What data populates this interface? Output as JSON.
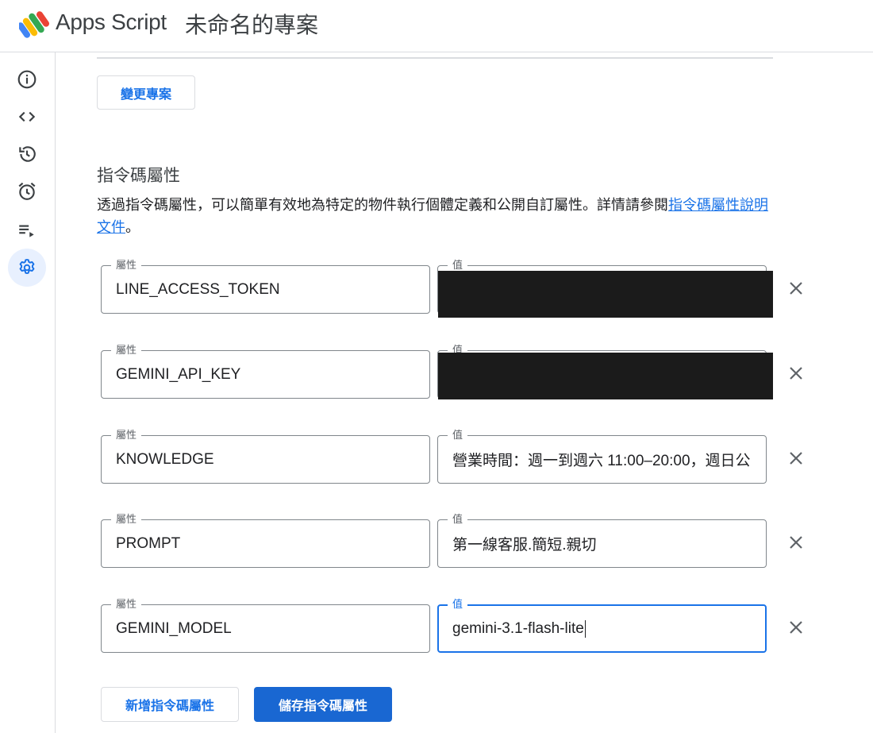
{
  "header": {
    "app_name": "Apps Script",
    "project_title": "未命名的專案"
  },
  "sidebar": {
    "items": [
      {
        "icon": "info-icon",
        "name": "overview"
      },
      {
        "icon": "code-icon",
        "name": "editor"
      },
      {
        "icon": "history-icon",
        "name": "executions"
      },
      {
        "icon": "alarm-icon",
        "name": "triggers"
      },
      {
        "icon": "playlist-icon",
        "name": "executions-log"
      },
      {
        "icon": "gear-icon",
        "name": "settings",
        "active": true
      }
    ]
  },
  "main": {
    "change_project_label": "變更專案",
    "section_title": "指令碼屬性",
    "description_text": "透過指令碼屬性，可以簡單有效地為特定的物件執行個體定義和公開自訂屬性。詳情請參閱",
    "description_link": "指令碼屬性說明文件",
    "description_end": "。",
    "property_label": "屬性",
    "value_label": "值",
    "properties": [
      {
        "key": "LINE_ACCESS_TOKEN",
        "value": "",
        "redacted": true
      },
      {
        "key": "GEMINI_API_KEY",
        "value": "",
        "redacted": true
      },
      {
        "key": "KNOWLEDGE",
        "value": "營業時間：週一到週六 11:00–20:00，週日公"
      },
      {
        "key": "PROMPT",
        "value": "第一線客服.簡短.親切"
      },
      {
        "key": "GEMINI_MODEL",
        "value": "gemini-3.1-flash-lite",
        "focused": true
      }
    ],
    "add_label": "新增指令碼屬性",
    "save_label": "儲存指令碼屬性"
  },
  "colors": {
    "accent": "#1a73e8",
    "primary_button": "#1967d2",
    "active_nav_bg": "#e8f0fe"
  }
}
